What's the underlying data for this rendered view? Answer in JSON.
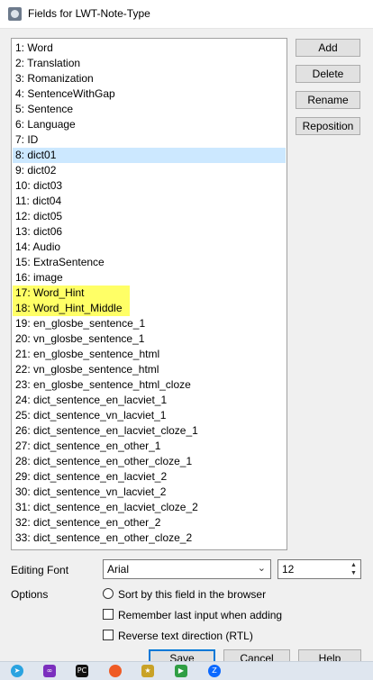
{
  "window": {
    "title": "Fields for LWT-Note-Type"
  },
  "fields": [
    "1: Word",
    "2: Translation",
    "3: Romanization",
    "4: SentenceWithGap",
    "5: Sentence",
    "6: Language",
    "7: ID",
    "8: dict01",
    "9: dict02",
    "10: dict03",
    "11: dict04",
    "12: dict05",
    "13: dict06",
    "14: Audio",
    "15: ExtraSentence",
    "16: image",
    "17: Word_Hint",
    "18: Word_Hint_Middle",
    "19: en_glosbe_sentence_1",
    "20: vn_glosbe_sentence_1",
    "21: en_glosbe_sentence_html",
    "22: vn_glosbe_sentence_html",
    "23: en_glosbe_sentence_html_cloze",
    "24: dict_sentence_en_lacviet_1",
    "25: dict_sentence_vn_lacviet_1",
    "26: dict_sentence_en_lacviet_cloze_1",
    "27: dict_sentence_en_other_1",
    "28: dict_sentence_en_other_cloze_1",
    "29: dict_sentence_en_lacviet_2",
    "30: dict_sentence_vn_lacviet_2",
    "31: dict_sentence_en_lacviet_cloze_2",
    "32: dict_sentence_en_other_2",
    "33: dict_sentence_en_other_cloze_2"
  ],
  "selected_index": 7,
  "highlighted_indices": [
    16,
    17
  ],
  "highlight_color": "#ffff66",
  "selection_color": "#cce8ff",
  "buttons": {
    "add": "Add",
    "delete": "Delete",
    "rename": "Rename",
    "reposition": "Reposition"
  },
  "editing_font": {
    "label": "Editing Font",
    "font_value": "Arial",
    "size_value": "12"
  },
  "options": {
    "label": "Options",
    "sort_radio": "Sort by this field in the browser",
    "remember_check": "Remember last input when adding",
    "rtl_check": "Reverse text direction (RTL)"
  },
  "bottom_buttons": {
    "save": "Save",
    "cancel": "Cancel",
    "help": "Help"
  },
  "taskbar_icons": [
    "telegram-icon",
    "visual-studio-icon",
    "pycharm-icon",
    "postman-icon",
    "anki-icon",
    "video-player-icon",
    "zalo-icon"
  ]
}
